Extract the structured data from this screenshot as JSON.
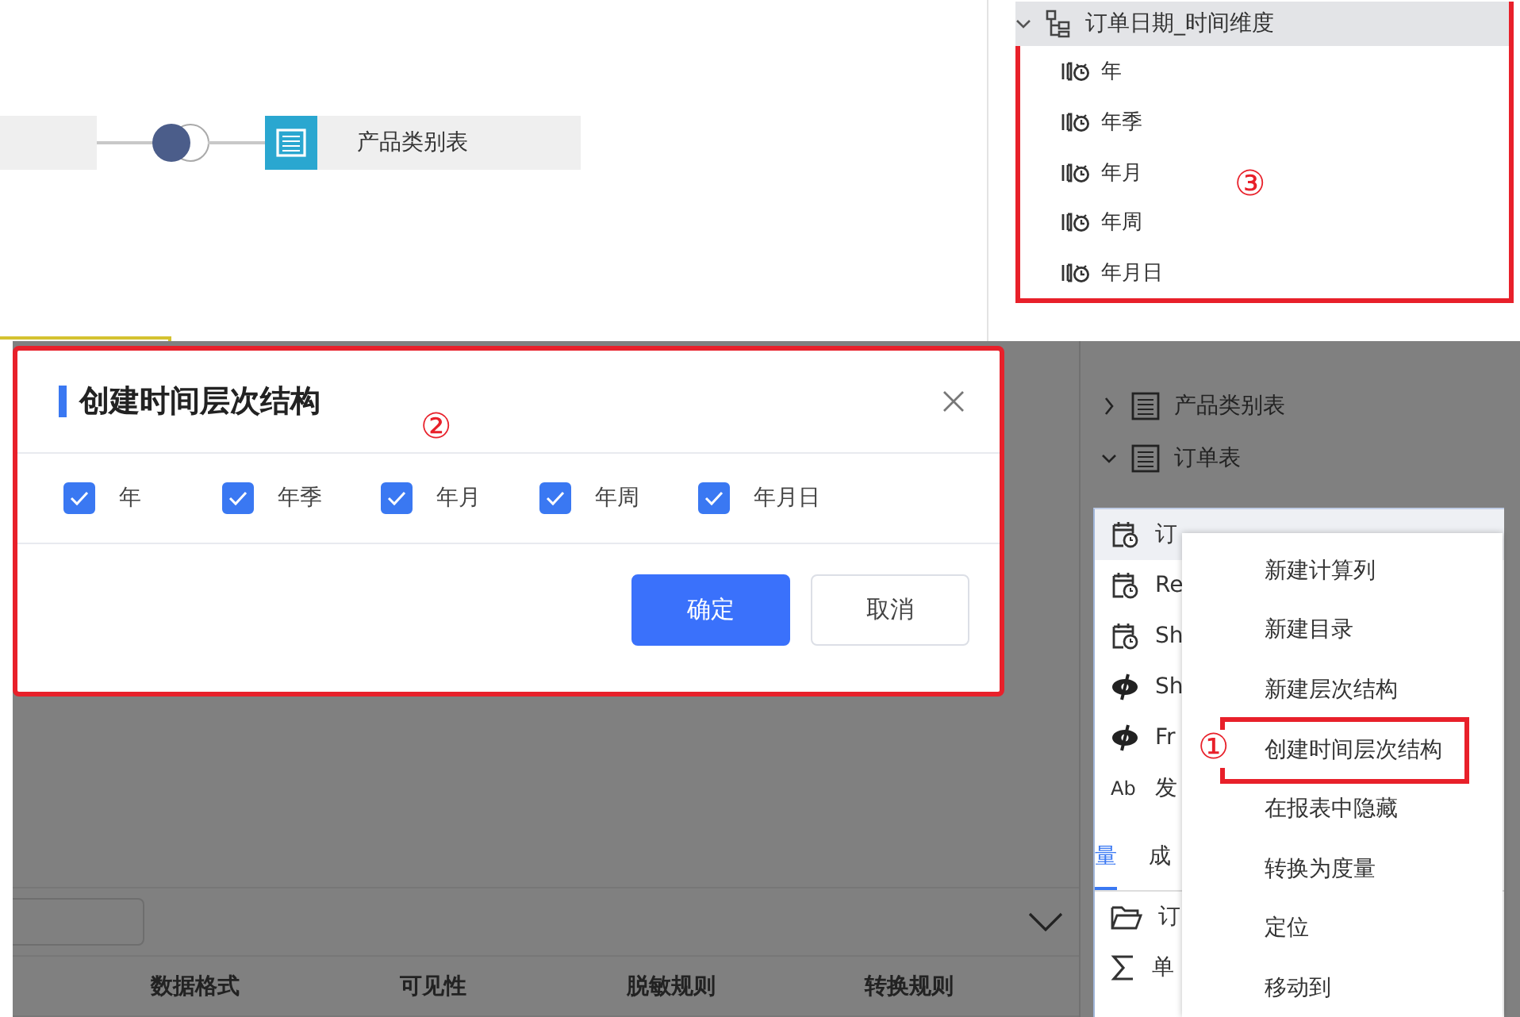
{
  "canvas": {
    "target_node": {
      "label": "产品类别表"
    }
  },
  "hierarchy_panel": {
    "annotation": "③",
    "hierarchy": {
      "label": "订单日期_时间维度",
      "expanded": true,
      "children": [
        {
          "label": "年"
        },
        {
          "label": "年季"
        },
        {
          "label": "年月"
        },
        {
          "label": "年周"
        },
        {
          "label": "年月日"
        }
      ]
    }
  },
  "model_tree": [
    {
      "label": "产品类别表",
      "expanded": false
    },
    {
      "label": "订单表",
      "expanded": true
    }
  ],
  "field_list": {
    "rows": [
      {
        "kind": "date",
        "label": "订",
        "selected": true
      },
      {
        "kind": "date",
        "label": "Re",
        "selected": false
      },
      {
        "kind": "date",
        "label": "Sh",
        "selected": false
      },
      {
        "kind": "hidden",
        "label": "Sh",
        "selected": false
      },
      {
        "kind": "hidden",
        "label": "Fr",
        "selected": false
      },
      {
        "kind": "text",
        "icon_text": "Ab",
        "label": "发",
        "selected": false
      }
    ],
    "tabs": [
      {
        "label": "量",
        "selected": true
      },
      {
        "label": "成",
        "selected": false
      }
    ],
    "folder": {
      "label": "订"
    },
    "measures": [
      {
        "label": "单"
      }
    ]
  },
  "context_menu": {
    "annotation": "①",
    "items": [
      {
        "label": "新建计算列",
        "highlighted": false
      },
      {
        "label": "新建目录",
        "highlighted": false
      },
      {
        "label": "新建层次结构",
        "highlighted": false
      },
      {
        "label": "创建时间层次结构",
        "highlighted": true
      },
      {
        "label": "在报表中隐藏",
        "highlighted": false
      },
      {
        "label": "转换为度量",
        "highlighted": false
      },
      {
        "label": "定位",
        "highlighted": false
      },
      {
        "label": "移动到",
        "highlighted": false
      }
    ]
  },
  "dialog": {
    "title": "创建时间层次结构",
    "annotation": "②",
    "options": [
      {
        "label": "年",
        "checked": true
      },
      {
        "label": "年季",
        "checked": true
      },
      {
        "label": "年月",
        "checked": true
      },
      {
        "label": "年周",
        "checked": true
      },
      {
        "label": "年月日",
        "checked": true
      }
    ],
    "buttons": [
      {
        "label": "确定",
        "kind": "primary"
      },
      {
        "label": "取消",
        "kind": "default"
      }
    ]
  },
  "grid": {
    "columns": [
      "数据格式",
      "可见性",
      "脱敏规则",
      "转换规则"
    ]
  }
}
